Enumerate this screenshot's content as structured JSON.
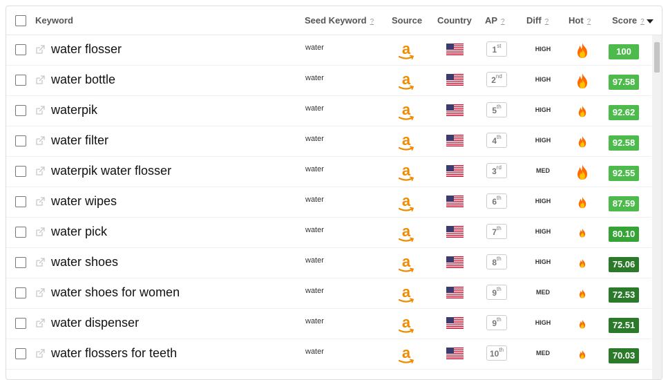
{
  "header": {
    "keyword": "Keyword",
    "seed_keyword": "Seed Keyword",
    "source": "Source",
    "country": "Country",
    "ap": "AP",
    "diff": "Diff",
    "hot": "Hot",
    "score": "Score",
    "help": "?"
  },
  "colors": {
    "score_light": "#4cbb4c",
    "score_mid": "#36a336",
    "score_dark": "#2a7a2a"
  },
  "rows": [
    {
      "keyword": "water flosser",
      "seed": "water",
      "ap": "1",
      "ap_suffix": "st",
      "diff": "HIGH",
      "hot": 3,
      "score": "100"
    },
    {
      "keyword": "water bottle",
      "seed": "water",
      "ap": "2",
      "ap_suffix": "nd",
      "diff": "HIGH",
      "hot": 3,
      "score": "97.58"
    },
    {
      "keyword": "waterpik",
      "seed": "water",
      "ap": "5",
      "ap_suffix": "th",
      "diff": "HIGH",
      "hot": 2,
      "score": "92.62"
    },
    {
      "keyword": "water filter",
      "seed": "water",
      "ap": "4",
      "ap_suffix": "th",
      "diff": "HIGH",
      "hot": 2,
      "score": "92.58"
    },
    {
      "keyword": "waterpik water flosser",
      "seed": "water",
      "ap": "3",
      "ap_suffix": "rd",
      "diff": "MED",
      "hot": 3,
      "score": "92.55"
    },
    {
      "keyword": "water wipes",
      "seed": "water",
      "ap": "6",
      "ap_suffix": "th",
      "diff": "HIGH",
      "hot": 2,
      "score": "87.59"
    },
    {
      "keyword": "water pick",
      "seed": "water",
      "ap": "7",
      "ap_suffix": "th",
      "diff": "HIGH",
      "hot": 1,
      "score": "80.10"
    },
    {
      "keyword": "water shoes",
      "seed": "water",
      "ap": "8",
      "ap_suffix": "th",
      "diff": "HIGH",
      "hot": 1,
      "score": "75.06"
    },
    {
      "keyword": "water shoes for women",
      "seed": "water",
      "ap": "9",
      "ap_suffix": "th",
      "diff": "MED",
      "hot": 1,
      "score": "72.53"
    },
    {
      "keyword": "water dispenser",
      "seed": "water",
      "ap": "9",
      "ap_suffix": "th",
      "diff": "HIGH",
      "hot": 1,
      "score": "72.51"
    },
    {
      "keyword": "water flossers for teeth",
      "seed": "water",
      "ap": "10",
      "ap_suffix": "th",
      "diff": "MED",
      "hot": 1,
      "score": "70.03"
    }
  ],
  "icons": {
    "source": "amazon-logo-icon",
    "country": "us-flag-icon",
    "hot": "fire-icon",
    "external": "external-link-icon"
  }
}
